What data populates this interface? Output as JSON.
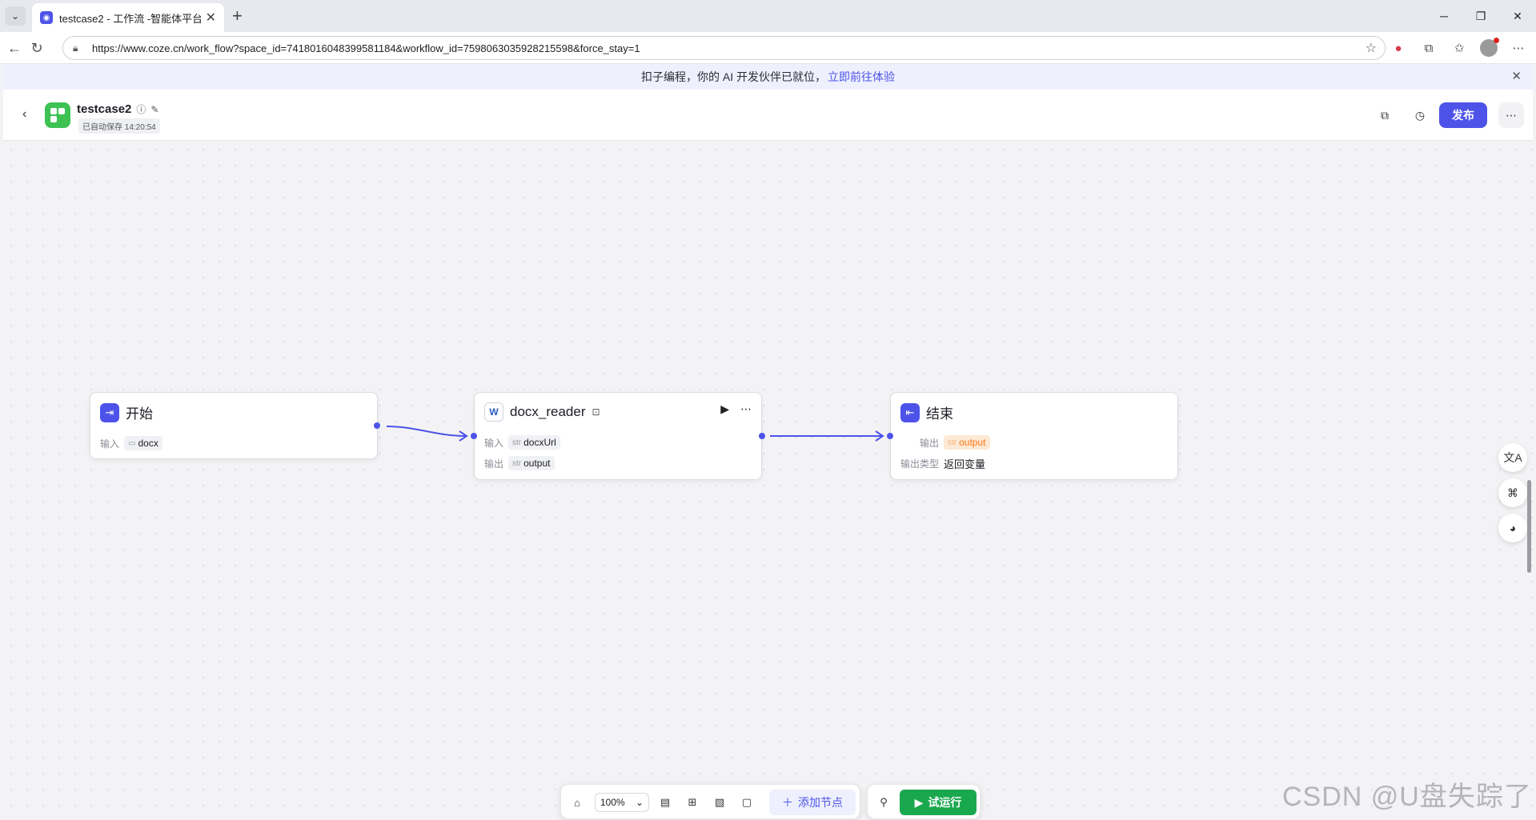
{
  "browser": {
    "tab_title": "testcase2 - 工作流 -智能体平台",
    "url": "https://www.coze.cn/work_flow?space_id=7418016048399581184&workflow_id=7598063035928215598&force_stay=1"
  },
  "banner": {
    "text": "扣子编程，你的 AI 开发伙伴已就位，",
    "link": "立即前往体验"
  },
  "header": {
    "title": "testcase2",
    "saved": "已自动保存 14:20:54",
    "publish_label": "发布"
  },
  "nodes": {
    "start": {
      "title": "开始",
      "input_label": "输入",
      "input_value": "docx"
    },
    "reader": {
      "title": "docx_reader",
      "input_label": "输入",
      "input_type": "str",
      "input_value": "docxUrl",
      "output_label": "输出",
      "output_type": "str",
      "output_value": "output"
    },
    "end": {
      "title": "结束",
      "output_label": "输出",
      "output_type": "str",
      "output_value": "output",
      "output_kind_label": "输出类型",
      "output_kind_value": "返回变量"
    }
  },
  "toolbar": {
    "zoom": "100%",
    "add_node_label": "添加节点",
    "run_label": "试运行"
  },
  "watermark": "CSDN @U盘失踪了",
  "colors": {
    "accent": "#4d53e8",
    "run_green": "#1aa84f",
    "output_orange": "#ff7a1a"
  }
}
